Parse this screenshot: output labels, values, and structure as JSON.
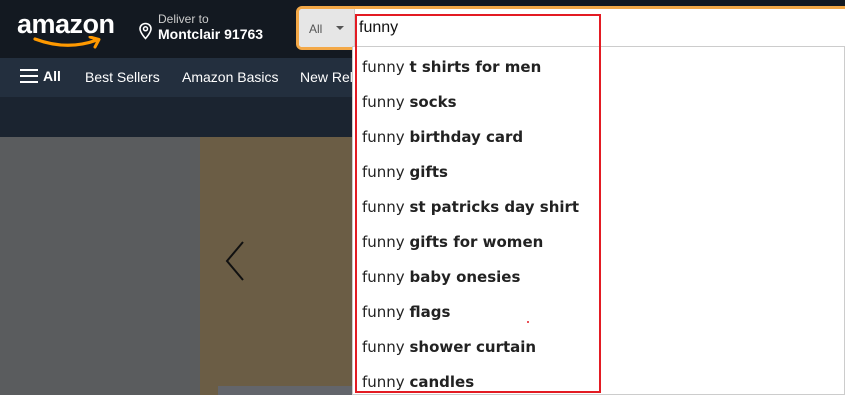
{
  "header": {
    "logo_text": "amazon",
    "deliver_to_label": "Deliver to",
    "deliver_location": "Montclair 91763"
  },
  "search": {
    "category": "All",
    "query": "funny"
  },
  "nav": {
    "all_label": "All",
    "items": [
      "Best Sellers",
      "Amazon Basics",
      "New Rel"
    ]
  },
  "suggestions": [
    {
      "prefix": "funny",
      "completion": "t shirts for men"
    },
    {
      "prefix": "funny",
      "completion": "socks"
    },
    {
      "prefix": "funny",
      "completion": "birthday card"
    },
    {
      "prefix": "funny",
      "completion": "gifts"
    },
    {
      "prefix": "funny",
      "completion": "st patricks day shirt"
    },
    {
      "prefix": "funny",
      "completion": "gifts for women"
    },
    {
      "prefix": "funny",
      "completion": "baby onesies"
    },
    {
      "prefix": "funny",
      "completion": "flags"
    },
    {
      "prefix": "funny",
      "completion": "shower curtain"
    },
    {
      "prefix": "funny",
      "completion": "candles"
    }
  ],
  "icons": {
    "logo_smile": "amazon-smile-arrow",
    "location": "map-pin-icon",
    "menu": "hamburger-icon",
    "carousel_prev": "chevron-left-icon",
    "category_caret": "caret-down-icon"
  },
  "colors": {
    "nav_top": "#131921",
    "nav_bottom": "#232f3e",
    "search_focus": "#f3a847",
    "logo_smile": "#ff9900",
    "highlight_box": "#e31b23"
  }
}
